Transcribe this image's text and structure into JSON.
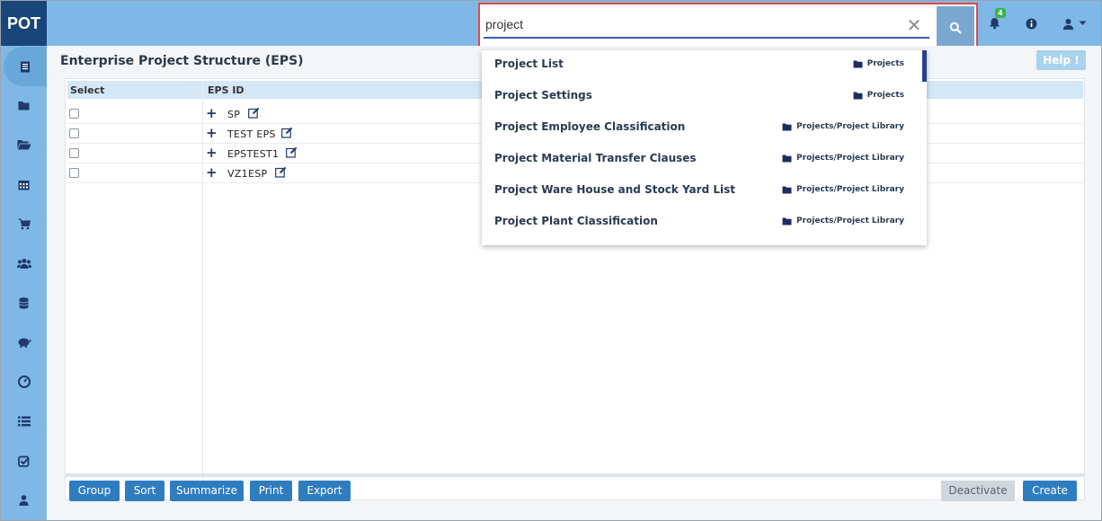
{
  "app": {
    "logo": "POT"
  },
  "search": {
    "value": "project",
    "clear_glyph": "✕"
  },
  "topbar": {
    "notification_count": "4"
  },
  "sidebar": {
    "items": [
      {
        "icon": "document-icon",
        "active": true
      },
      {
        "icon": "folder-icon"
      },
      {
        "icon": "folder-open-icon"
      },
      {
        "icon": "calendar-icon"
      },
      {
        "icon": "cart-icon"
      },
      {
        "icon": "users-icon"
      },
      {
        "icon": "database-icon"
      },
      {
        "icon": "piggy-bank-icon"
      },
      {
        "icon": "dashboard-icon"
      },
      {
        "icon": "list-icon"
      },
      {
        "icon": "checkbox-icon"
      },
      {
        "icon": "user-icon"
      }
    ]
  },
  "page": {
    "title": "Enterprise Project Structure (EPS)",
    "help_label": "Help !"
  },
  "grid": {
    "columns": {
      "select": "Select",
      "eps_id": "EPS ID"
    },
    "rows": [
      {
        "id": "SP"
      },
      {
        "id": "TEST EPS"
      },
      {
        "id": "EPSTEST1"
      },
      {
        "id": "VZ1ESP"
      }
    ]
  },
  "dropdown": {
    "items": [
      {
        "label": "Project List",
        "path": "Projects"
      },
      {
        "label": "Project Settings",
        "path": "Projects"
      },
      {
        "label": "Project Employee Classification",
        "path": "Projects/Project Library"
      },
      {
        "label": "Project Material Transfer Clauses",
        "path": "Projects/Project Library"
      },
      {
        "label": "Project Ware House and Stock Yard List",
        "path": "Projects/Project Library"
      },
      {
        "label": "Project Plant Classification",
        "path": "Projects/Project Library"
      }
    ]
  },
  "buttons": {
    "group": "Group",
    "sort": "Sort",
    "summarize": "Summarize",
    "print": "Print",
    "export": "Export",
    "deactivate": "Deactivate",
    "create": "Create"
  },
  "colors": {
    "topbar": "#7fb8e6",
    "logo_bg": "#18467a",
    "primary_button": "#2f7dbf",
    "highlight_border": "#e0484c"
  }
}
